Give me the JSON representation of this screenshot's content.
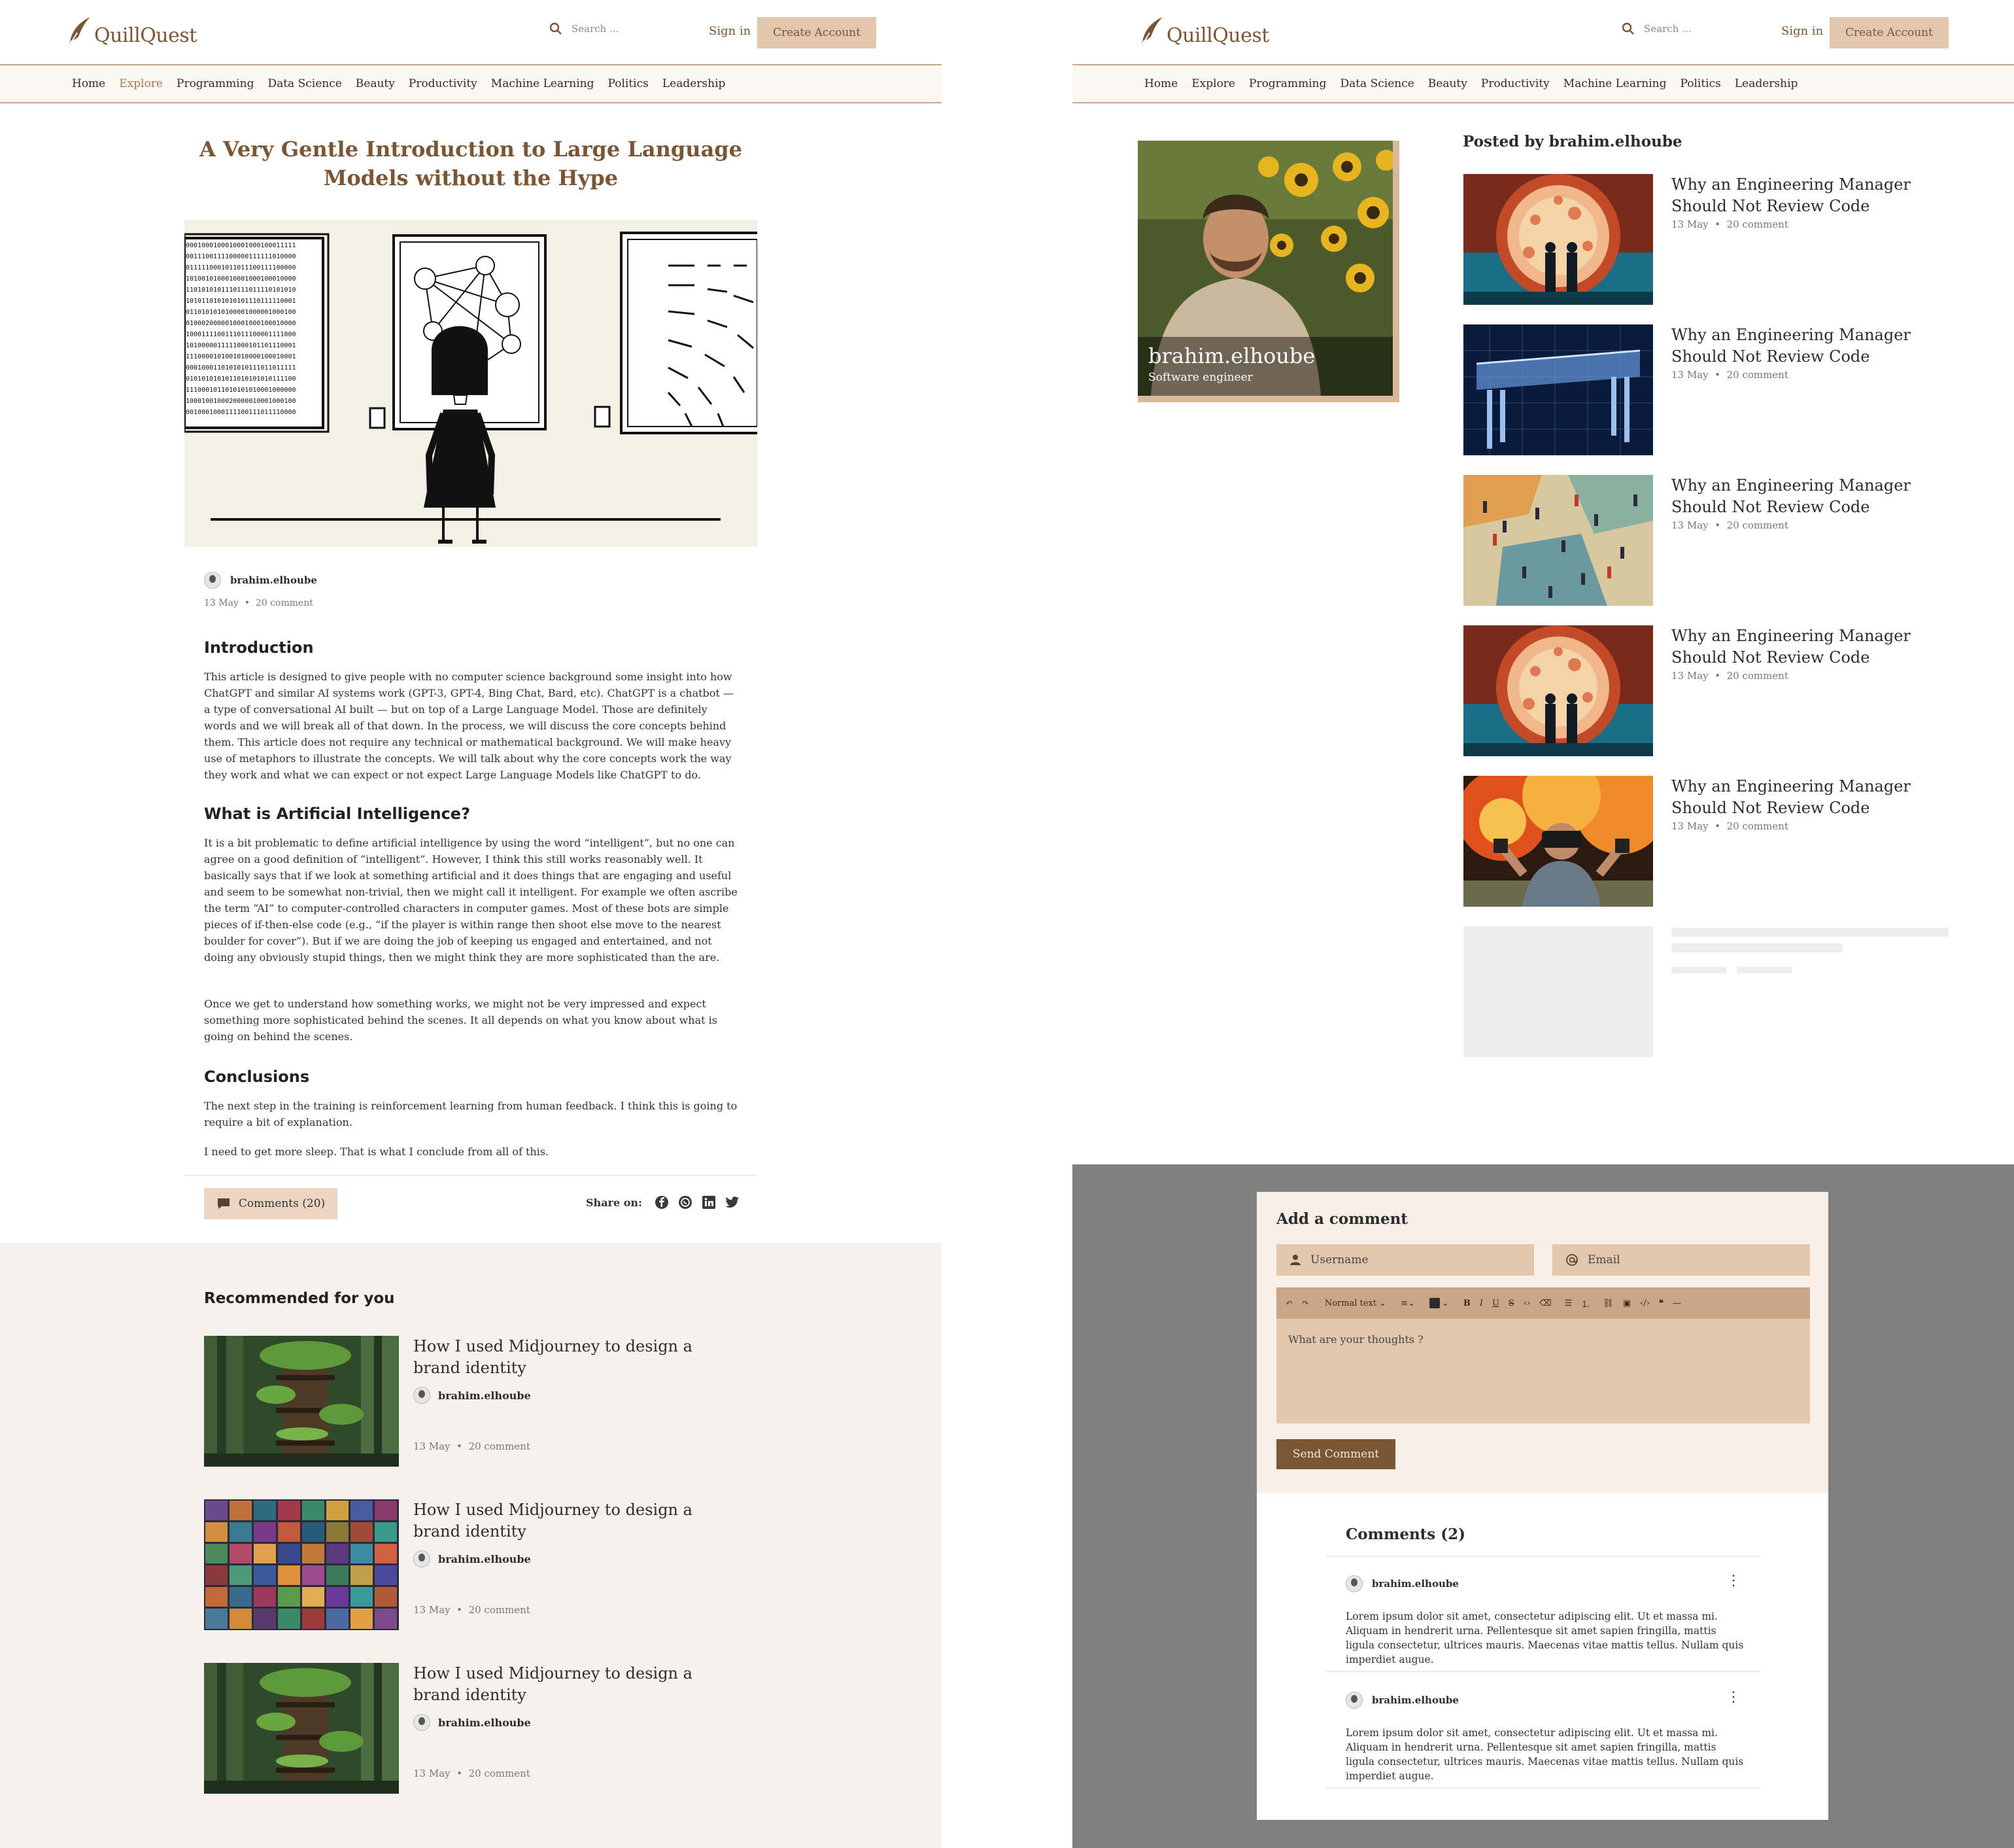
{
  "brand": {
    "name": "QuillQuest"
  },
  "header": {
    "search_placeholder": "Search ...",
    "signin_label": "Sign in",
    "create_label": "Create Account"
  },
  "nav": {
    "items": [
      "Home",
      "Explore",
      "Programming",
      "Data Science",
      "Beauty",
      "Productivity",
      "Machine Learning",
      "Politics",
      "Leadership"
    ],
    "active": "Explore"
  },
  "article": {
    "title": "A Very Gentle Introduction to Large Language Models without the Hype",
    "author": "brahim.elhoube",
    "date": "13 May",
    "comment_count": "20 comment",
    "sections": [
      {
        "heading": "Introduction",
        "paragraphs": [
          "This article is designed to give people with no computer science background some insight into how ChatGPT and similar AI systems work (GPT-3, GPT-4, Bing Chat, Bard, etc). ChatGPT is a chatbot — a type of conversational AI built — but on top of a Large Language Model. Those are definitely words and we will break all of that down. In the process, we will discuss the core concepts behind them. This article does not require any technical or mathematical background. We will make heavy use of metaphors to illustrate the concepts. We will talk about why the core concepts work the way they work and what we can expect or not expect Large Language Models like ChatGPT to do."
        ]
      },
      {
        "heading": "What is Artificial Intelligence?",
        "paragraphs": [
          "It is a bit problematic to define artificial intelligence by using the word “intelligent”, but no one can agree on a good definition of “intelligent”. However, I think this still works reasonably well. It basically says that if we look at something artificial and it does things that are engaging and useful and seem to be somewhat non-trivial, then we might call it intelligent. For example we often ascribe the term “AI” to computer-controlled characters in computer games. Most of these bots are simple pieces of if-then-else code (e.g., “if the player is within range then shoot else move to the nearest boulder for cover”). But if we are doing the job of keeping us engaged and entertained, and not doing any obviously stupid things, then we might think they are more sophisticated than the are.",
          "Once we get to understand how something works, we might not be very impressed and expect something more sophisticated behind the scenes. It all depends on what you know about what is going on behind the scenes."
        ]
      },
      {
        "heading": "Conclusions",
        "paragraphs": [
          "The next step in the training is reinforcement learning from human feedback. I think this is going to require a bit of explanation.",
          "I need to get more sleep. That is what I conclude from all of this."
        ]
      }
    ],
    "comments_button": "Comments (20)",
    "share_label": "Share on:"
  },
  "recommended": {
    "heading": "Recommended for you",
    "items": [
      {
        "title": "How I used Midjourney to design a brand identity",
        "author": "brahim.elhoube",
        "date": "13 May",
        "comments": "20 comment",
        "image": "treehouse-forest"
      },
      {
        "title": "How I used Midjourney to design a brand identity",
        "author": "brahim.elhoube",
        "date": "13 May",
        "comments": "20 comment",
        "image": "portrait-grid"
      },
      {
        "title": "How I used Midjourney to design a brand identity",
        "author": "brahim.elhoube",
        "date": "13 May",
        "comments": "20 comment",
        "image": "treehouse-forest"
      }
    ]
  },
  "profile": {
    "name": "brahim.elhoube",
    "role": "Software engineer"
  },
  "posts": {
    "heading": "Posted by brahim.elhoube",
    "items": [
      {
        "title": "Why an Engineering Manager Should Not Review Code",
        "date": "13 May",
        "comments": "20 comment",
        "image": "portal-two-men"
      },
      {
        "title": "Why an Engineering Manager Should Not Review Code",
        "date": "13 May",
        "comments": "20 comment",
        "image": "blueprint-table"
      },
      {
        "title": "Why an Engineering Manager Should Not Review Code",
        "date": "13 May",
        "comments": "20 comment",
        "image": "crowd-puzzle"
      },
      {
        "title": "Why an Engineering Manager Should Not Review Code",
        "date": "13 May",
        "comments": "20 comment",
        "image": "portal-two-men"
      },
      {
        "title": "Why an Engineering Manager Should Not Review Code",
        "date": "13 May",
        "comments": "20 comment",
        "image": "vr-explosion"
      }
    ]
  },
  "comment_form": {
    "heading": "Add a comment",
    "username_placeholder": "Username",
    "email_placeholder": "Email",
    "text_style": "Normal text",
    "editor_placeholder": "What are your thoughts ?",
    "send_label": "Send Comment"
  },
  "comments": {
    "heading": "Comments (2)",
    "items": [
      {
        "author": "brahim.elhoube",
        "text": "Lorem ipsum dolor sit amet, consectetur adipiscing elit. Ut et massa mi. Aliquam in hendrerit urna. Pellentesque sit amet sapien fringilla, mattis ligula consectetur, ultrices mauris. Maecenas vitae mattis tellus. Nullam quis imperdiet augue."
      },
      {
        "author": "brahim.elhoube",
        "text": "Lorem ipsum dolor sit amet, consectetur adipiscing elit. Ut et massa mi. Aliquam in hendrerit urna. Pellentesque sit amet sapien fringilla, mattis ligula consectetur, ultrices mauris. Maecenas vitae mattis tellus. Nullam quis imperdiet augue."
      }
    ]
  },
  "colors": {
    "brand": "#7a5634",
    "accent": "#e3c7ad",
    "panel": "#f6f1eb"
  }
}
